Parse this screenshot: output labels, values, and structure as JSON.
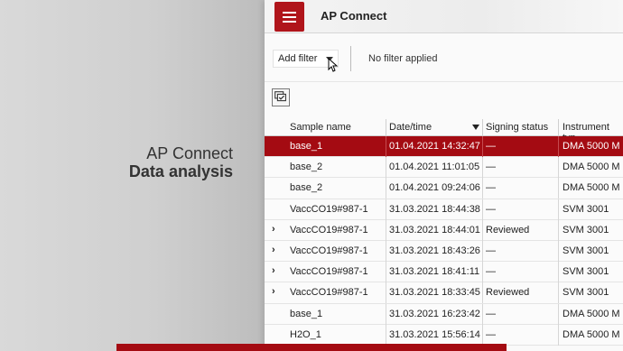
{
  "brand": {
    "line1": "AP Connect",
    "line2": "Data analysis"
  },
  "titlebar": {
    "title": "AP Connect"
  },
  "filter": {
    "select_label": "Add filter",
    "status": "No filter applied"
  },
  "table": {
    "columns": [
      "Sample name",
      "Date/time",
      "Signing status",
      "Instrument typ"
    ],
    "rows": [
      {
        "expand": "",
        "name": "base_1",
        "datetime": "01.04.2021 14:32:47",
        "status": "—",
        "instrument": "DMA 5000 M",
        "selected": true
      },
      {
        "expand": "",
        "name": "base_2",
        "datetime": "01.04.2021 11:01:05",
        "status": "—",
        "instrument": "DMA 5000 M"
      },
      {
        "expand": "",
        "name": "base_2",
        "datetime": "01.04.2021 09:24:06",
        "status": "—",
        "instrument": "DMA 5000 M"
      },
      {
        "expand": "",
        "name": "VaccCO19#987-1",
        "datetime": "31.03.2021 18:44:38",
        "status": "—",
        "instrument": "SVM 3001"
      },
      {
        "expand": "›",
        "name": "VaccCO19#987-1",
        "datetime": "31.03.2021 18:44:01",
        "status": "Reviewed",
        "instrument": "SVM 3001"
      },
      {
        "expand": "›",
        "name": "VaccCO19#987-1",
        "datetime": "31.03.2021 18:43:26",
        "status": "—",
        "instrument": "SVM 3001"
      },
      {
        "expand": "›",
        "name": "VaccCO19#987-1",
        "datetime": "31.03.2021 18:41:11",
        "status": "—",
        "instrument": "SVM 3001"
      },
      {
        "expand": "›",
        "name": "VaccCO19#987-1",
        "datetime": "31.03.2021 18:33:45",
        "status": "Reviewed",
        "instrument": "SVM 3001"
      },
      {
        "expand": "",
        "name": "base_1",
        "datetime": "31.03.2021 16:23:42",
        "status": "—",
        "instrument": "DMA 5000 M"
      },
      {
        "expand": "",
        "name": "H2O_1",
        "datetime": "31.03.2021 15:56:14",
        "status": "—",
        "instrument": "DMA 5000 M"
      }
    ]
  },
  "colors": {
    "accent": "#a40b12",
    "menu": "#b0151b"
  },
  "icons": [
    "menu-icon",
    "dropdown-caret-icon",
    "mouse-cursor-icon",
    "multi-select-icon",
    "sort-desc-icon",
    "chevron-right-icon"
  ]
}
